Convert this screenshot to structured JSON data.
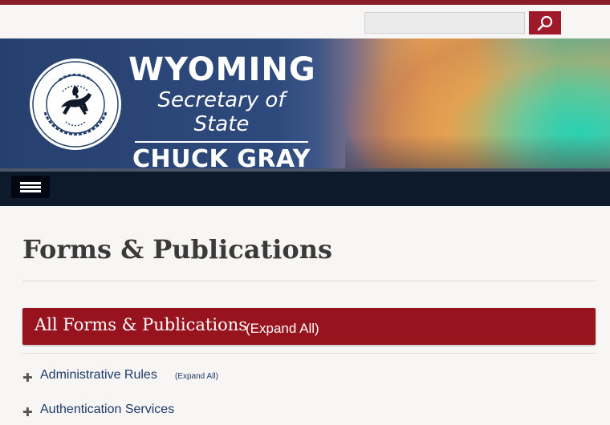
{
  "search": {
    "placeholder": "",
    "value": "",
    "button_icon": "search-icon"
  },
  "banner": {
    "title": "WYOMING",
    "subtitle": "Secretary of State",
    "name": "CHUCK GRAY",
    "seal": {
      "icon": "state-seal-bucking-horse"
    }
  },
  "nav": {
    "menu_icon": "hamburger-menu-icon"
  },
  "page": {
    "title": "Forms & Publications"
  },
  "section": {
    "title": "All Forms & Publications",
    "expand_label": "(Expand All)"
  },
  "list": {
    "items": [
      {
        "label": "Administrative Rules",
        "expand_label": "(Expand All)"
      },
      {
        "label": "Authentication Services",
        "expand_label": ""
      }
    ]
  },
  "colors": {
    "brand_red": "#97141f",
    "navy": "#0c1a2c",
    "link": "#1e3a6a"
  }
}
